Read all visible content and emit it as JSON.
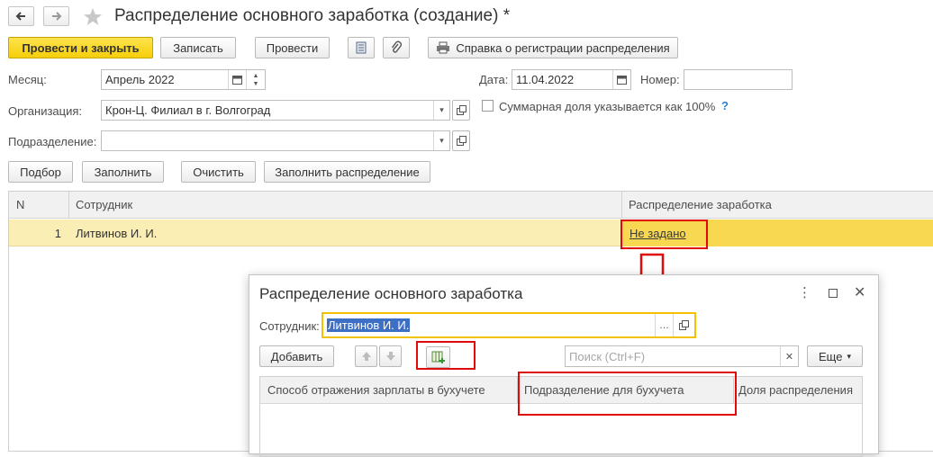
{
  "window": {
    "title": "Распределение основного заработка (создание) *",
    "back_icon": "arrow-left-icon",
    "forward_icon": "arrow-right-icon",
    "star_icon": "star-icon"
  },
  "toolbar": {
    "post_close_label": "Провести и закрыть",
    "save_label": "Записать",
    "post_label": "Провести",
    "report_label": "Справка о регистрации распределения"
  },
  "form": {
    "month_label": "Месяц:",
    "month_value": "Апрель 2022",
    "date_label": "Дата:",
    "date_value": "11.04.2022",
    "number_label": "Номер:",
    "number_value": "",
    "org_label": "Организация:",
    "org_value": "Крон-Ц. Филиал в г. Волгоград",
    "total_share_label": "Суммарная доля указывается как 100%",
    "help_mark": "?",
    "division_label": "Подразделение:",
    "division_value": ""
  },
  "table_buttons": {
    "pick_label": "Подбор",
    "fill_label": "Заполнить",
    "clear_label": "Очистить",
    "fill_dist_label": "Заполнить распределение"
  },
  "table": {
    "columns": [
      "N",
      "Сотрудник",
      "Распределение заработка"
    ],
    "rows": [
      {
        "n": "1",
        "employee": "Литвинов И. И.",
        "distribution": "Не задано"
      }
    ]
  },
  "dialog": {
    "title": "Распределение основного заработка",
    "employee_label": "Сотрудник:",
    "employee_value": "Литвинов И. И.",
    "add_label": "Добавить",
    "search_placeholder": "Поиск (Ctrl+F)",
    "more_label": "Еще",
    "columns": [
      "Способ отражения зарплаты в бухучете",
      "Подразделение для бухучета",
      "Доля распределения"
    ]
  },
  "colors": {
    "primary": "#f6cf09",
    "highlight_row": "#fbeeb5",
    "annotation": "#e10a0a",
    "link": "#3a3a3a"
  }
}
